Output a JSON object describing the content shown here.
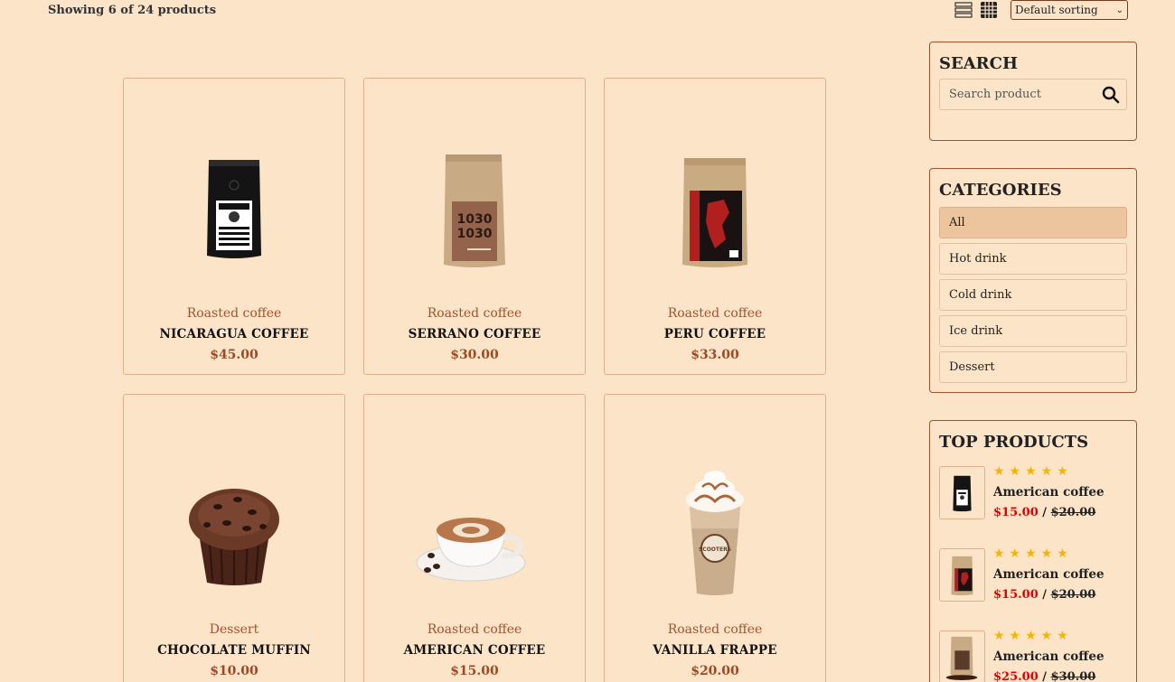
{
  "toolbar": {
    "showing": "Showing 6 of 24 products",
    "list_view_icon": "list-view-icon",
    "grid_view_icon": "grid-view-icon",
    "sorting": "Default sorting"
  },
  "products": [
    {
      "category": "Roasted coffee",
      "name": "NICARAGUA COFFEE",
      "price": "$45.00",
      "image": "black-coffee-bag"
    },
    {
      "category": "Roasted coffee",
      "name": "SERRANO COFFEE",
      "price": "$30.00",
      "image": "kraft-coffee-bag"
    },
    {
      "category": "Roasted coffee",
      "name": "PERU COFFEE",
      "price": "$33.00",
      "image": "kraft-red-label-bag"
    },
    {
      "category": "Dessert",
      "name": "CHOCOLATE MUFFIN",
      "price": "$10.00",
      "image": "chocolate-muffin"
    },
    {
      "category": "Roasted coffee",
      "name": "AMERICAN COFFEE",
      "price": "$15.00",
      "image": "latte-cup"
    },
    {
      "category": "Roasted coffee",
      "name": "VANILLA FRAPPE",
      "price": "$20.00",
      "image": "frappe-cup"
    }
  ],
  "sidebar": {
    "search": {
      "title": "SEARCH",
      "placeholder": "Search product",
      "icon": "search-icon"
    },
    "categories": {
      "title": "CATEGORIES",
      "items": [
        "All",
        "Hot drink",
        "Cold drink",
        "Ice drink",
        "Dessert"
      ],
      "active": "All"
    },
    "top_products": {
      "title": "TOP PRODUCTS",
      "items": [
        {
          "name": "American coffee",
          "rating": 5,
          "price": "$15.00",
          "old_price": "$20.00",
          "image": "black-coffee-bag"
        },
        {
          "name": "American coffee",
          "rating": 5,
          "price": "$15.00",
          "old_price": "$20.00",
          "image": "kraft-red-label-bag"
        },
        {
          "name": "American coffee",
          "rating": 5,
          "price": "$25.00",
          "old_price": "$30.00",
          "image": "kraft-coffee-bag"
        }
      ]
    }
  },
  "colors": {
    "background": "#fce4c9",
    "accent": "#a0522d",
    "sale_price": "#e00000",
    "star": "#f5b400",
    "active_category": "#ecc49e"
  }
}
